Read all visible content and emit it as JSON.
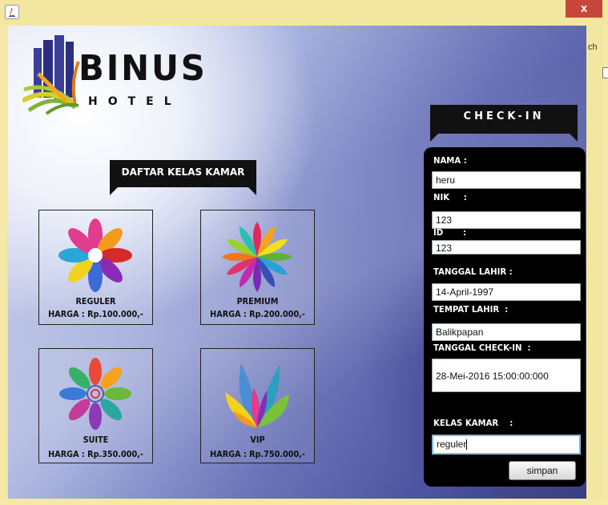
{
  "window": {
    "close_glyph": "x"
  },
  "side_text": "ch",
  "brand": {
    "name": "BINUS",
    "sub": "HOTEL"
  },
  "daftar": {
    "title": "DAFTAR KELAS KAMAR"
  },
  "rooms": [
    {
      "name": "REGULER",
      "price": "HARGA : Rp.100.000,-",
      "icon": "flower-reguler-icon"
    },
    {
      "name": "PREMIUM",
      "price": "HARGA : Rp.200.000,-",
      "icon": "lotus-premium-icon"
    },
    {
      "name": "SUITE",
      "price": "HARGA : Rp.350.000,-",
      "icon": "flower-suite-icon"
    },
    {
      "name": "VIP",
      "price": "HARGA : Rp.750.000,-",
      "icon": "leaves-vip-icon"
    }
  ],
  "checkin": {
    "title": "CHECK-IN",
    "fields": {
      "nama": {
        "label": "NAMA :",
        "value": "heru"
      },
      "nik": {
        "label": "NIK     :",
        "value": "123"
      },
      "id": {
        "label": "ID       :",
        "value": "123"
      },
      "tanggal_lahir": {
        "label": "TANGGAL LAHIR :",
        "value": "14-April-1997"
      },
      "tempat_lahir": {
        "label": "TEMPAT LAHIR  :",
        "value": "Balikpapan"
      },
      "tanggal_checkin": {
        "label": "TANGGAL CHECK-IN  :",
        "value": "28-Mei-2016 15:00:00:000"
      },
      "kelas_kamar": {
        "label": "KELAS KAMAR    :",
        "value": "reguler"
      }
    },
    "submit_label": "simpan"
  }
}
